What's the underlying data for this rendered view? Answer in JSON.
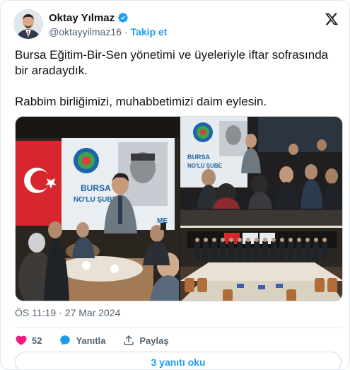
{
  "tweet": {
    "author": {
      "display_name": "Oktay Yılmaz",
      "handle": "@oktayyilmaz16",
      "separator": "·",
      "follow_label": "Takip et",
      "verified_color": "#1d9bf0"
    },
    "text_line1": "Bursa Eğitim-Bir-Sen yönetimi ve üyeleriyle iftar sofrasında bir aradaydık.",
    "text_line2": "Rabbim birliğimizi, muhabbetimizi daim eylesin.",
    "media": {
      "banner_text_1": "BURSA",
      "banner_text_2": "NO'LU ŞUBE",
      "banner_text_3": "ME"
    },
    "timestamp": {
      "time": "ÖS 11:19",
      "separator": "·",
      "date": "27 Mar 2024"
    },
    "actions": {
      "like_count": "52",
      "reply_label": "Yanıtla",
      "share_label": "Paylaş"
    },
    "read_replies_label": "3 yanıtı oku"
  },
  "colors": {
    "accent": "#1d9bf0",
    "like": "#f91880",
    "text_secondary": "#536471"
  },
  "icons": [
    "x-logo-icon",
    "verified-badge-icon",
    "heart-icon",
    "reply-bubble-icon",
    "share-icon"
  ]
}
